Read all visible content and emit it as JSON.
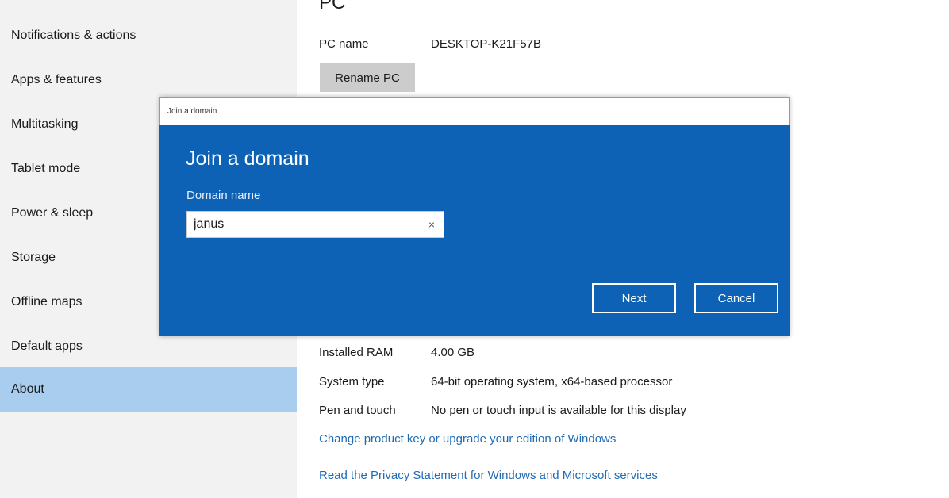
{
  "sidebar": {
    "items": [
      {
        "label": "Notifications & actions"
      },
      {
        "label": "Apps & features"
      },
      {
        "label": "Multitasking"
      },
      {
        "label": "Tablet mode"
      },
      {
        "label": "Power & sleep"
      },
      {
        "label": "Storage"
      },
      {
        "label": "Offline maps"
      },
      {
        "label": "Default apps"
      },
      {
        "label": "About",
        "selected": true
      }
    ]
  },
  "main": {
    "heading": "PC",
    "pc_name_label": "PC name",
    "pc_name_value": "DESKTOP-K21F57B",
    "rename_button": "Rename PC",
    "specs": [
      {
        "label": "Installed RAM",
        "value": "4.00 GB"
      },
      {
        "label": "System type",
        "value": "64-bit operating system, x64-based processor"
      },
      {
        "label": "Pen and touch",
        "value": "No pen or touch input is available for this display"
      }
    ],
    "links": [
      "Change product key or upgrade your edition of Windows",
      "Read the Privacy Statement for Windows and Microsoft services"
    ]
  },
  "dialog": {
    "window_title": "Join a domain",
    "heading": "Join a domain",
    "field_label": "Domain name",
    "field_value": "janus",
    "clear_icon": "×",
    "next_button": "Next",
    "cancel_button": "Cancel"
  },
  "colors": {
    "accent": "#0e62b5",
    "selected_item": "#a8cdee",
    "link": "#1f6bb5"
  }
}
